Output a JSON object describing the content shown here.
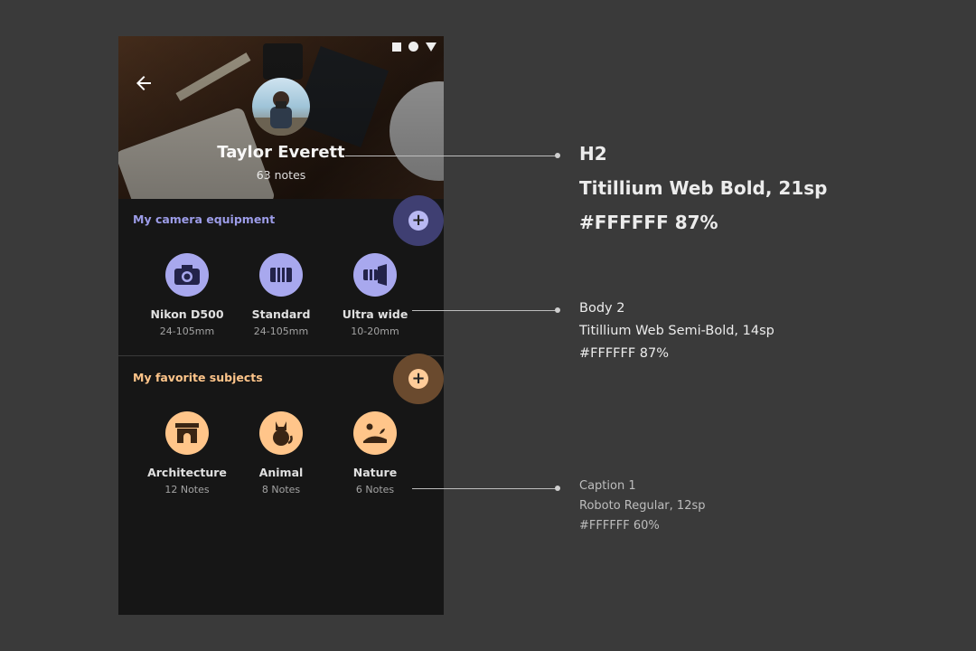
{
  "status_bar": {
    "icons": [
      "square-icon",
      "circle-icon",
      "triangle-icon"
    ]
  },
  "profile": {
    "name": "Taylor Everett",
    "notes": "63 notes"
  },
  "equipment": {
    "title": "My camera equipment",
    "accent": "#9C9CE8",
    "items": [
      {
        "label": "Nikon D500",
        "sub": "24-105mm",
        "icon": "camera-icon"
      },
      {
        "label": "Standard",
        "sub": "24-105mm",
        "icon": "lens-icon"
      },
      {
        "label": "Ultra wide",
        "sub": "10-20mm",
        "icon": "wide-lens-icon"
      }
    ]
  },
  "subjects": {
    "title": "My favorite subjects",
    "accent": "#FFC58A",
    "items": [
      {
        "label": "Architecture",
        "sub": "12 Notes",
        "icon": "arch-icon"
      },
      {
        "label": "Animal",
        "sub": "8 Notes",
        "icon": "cat-icon"
      },
      {
        "label": "Nature",
        "sub": "6 Notes",
        "icon": "nature-icon"
      }
    ]
  },
  "specs": {
    "h2": {
      "line1": "H2",
      "line2": "Titillium Web Bold, 21sp",
      "line3": "#FFFFFF 87%"
    },
    "body2": {
      "line1": "Body 2",
      "line2": "Titillium Web Semi-Bold, 14sp",
      "line3": "#FFFFFF 87%"
    },
    "caption1": {
      "line1": "Caption 1",
      "line2": "Roboto Regular, 12sp",
      "line3": "#FFFFFF 60%"
    }
  }
}
